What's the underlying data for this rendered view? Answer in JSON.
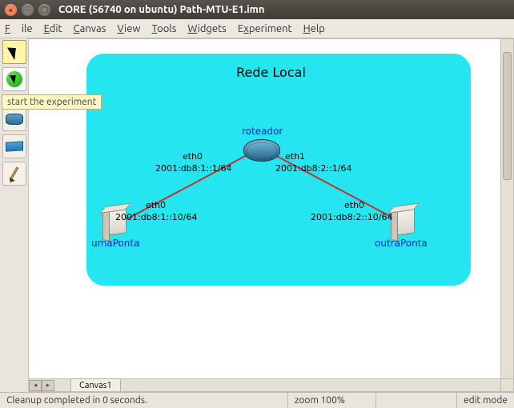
{
  "window": {
    "title": "CORE (56740 on ubuntu) Path-MTU-E1.imn",
    "close_sym": "×",
    "min_sym": "–",
    "max_sym": "▢"
  },
  "menu": {
    "file": "File",
    "edit": "Edit",
    "canvas": "Canvas",
    "view": "View",
    "tools": "Tools",
    "widgets": "Widgets",
    "experiment": "Experiment",
    "help": "Help"
  },
  "toolbar": {
    "select_name": "select-tool",
    "run_name": "start-experiment",
    "tooltip": "start the experiment",
    "node_dot_name": "node-marker",
    "router_name": "router-node-tool",
    "switch_name": "switch-node-tool",
    "draw_name": "annotation-tool"
  },
  "topology": {
    "background_label": "Rede Local",
    "router": {
      "label": "roteador",
      "eth0": {
        "if": "eth0",
        "addr": "2001:db8:1::1/64"
      },
      "eth1": {
        "if": "eth1",
        "addr": "2001:db8:2::1/64"
      }
    },
    "hostA": {
      "label": "umaPonta",
      "eth0": {
        "if": "eth0",
        "addr": "2001:db8:1::10/64"
      }
    },
    "hostB": {
      "label": "outraPonta",
      "eth0": {
        "if": "eth0",
        "addr": "2001:db8:2::10/64"
      }
    }
  },
  "bottom": {
    "tab": "Canvas1"
  },
  "status": {
    "message": "Cleanup completed in 0 seconds.",
    "zoom": "zoom 100%",
    "mode": "edit mode"
  }
}
